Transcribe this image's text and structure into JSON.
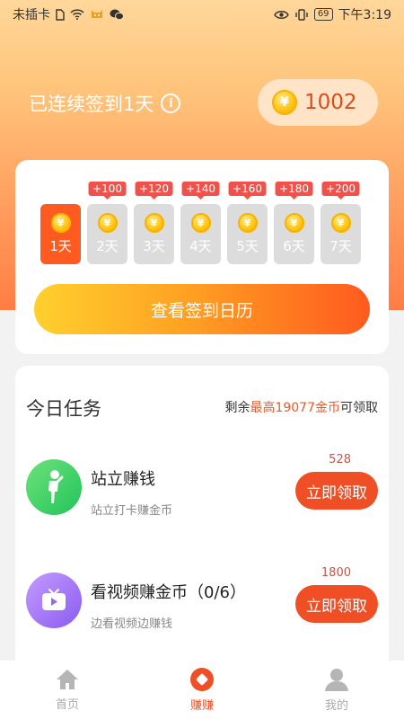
{
  "status_bar": {
    "carrier": "未插卡",
    "battery": "69",
    "time": "下午3:19"
  },
  "header": {
    "streak_text": "已连续签到1天",
    "info_icon": "info-icon",
    "coins": "1002"
  },
  "signin": {
    "days": [
      {
        "label": "1天",
        "bonus": "",
        "active": true
      },
      {
        "label": "2天",
        "bonus": "+100",
        "active": false
      },
      {
        "label": "3天",
        "bonus": "+120",
        "active": false
      },
      {
        "label": "4天",
        "bonus": "+140",
        "active": false
      },
      {
        "label": "5天",
        "bonus": "+160",
        "active": false
      },
      {
        "label": "6天",
        "bonus": "+180",
        "active": false
      },
      {
        "label": "7天",
        "bonus": "+200",
        "active": false
      }
    ],
    "coin_symbol": "¥",
    "calendar_button": "查看签到日历"
  },
  "tasks": {
    "title": "今日任务",
    "remain_prefix": "剩余",
    "remain_highlight": "最高19077金币",
    "remain_suffix": "可领取",
    "items": [
      {
        "title": "站立赚钱",
        "subtitle": "站立打卡赚金币",
        "amount": "528",
        "button": "立即领取",
        "icon": "standing-person-icon"
      },
      {
        "title": "看视频赚金币（0/6）",
        "subtitle": "边看视频边赚钱",
        "amount": "1800",
        "button": "立即领取",
        "icon": "video-play-icon"
      }
    ]
  },
  "bottom_nav": {
    "items": [
      {
        "label": "首页",
        "icon": "home-icon",
        "active": false
      },
      {
        "label": "赚赚",
        "icon": "earn-icon",
        "active": true
      },
      {
        "label": "我的",
        "icon": "user-icon",
        "active": false
      }
    ]
  },
  "colors": {
    "accent": "#f04e24",
    "coin_text": "#d94d1c"
  }
}
